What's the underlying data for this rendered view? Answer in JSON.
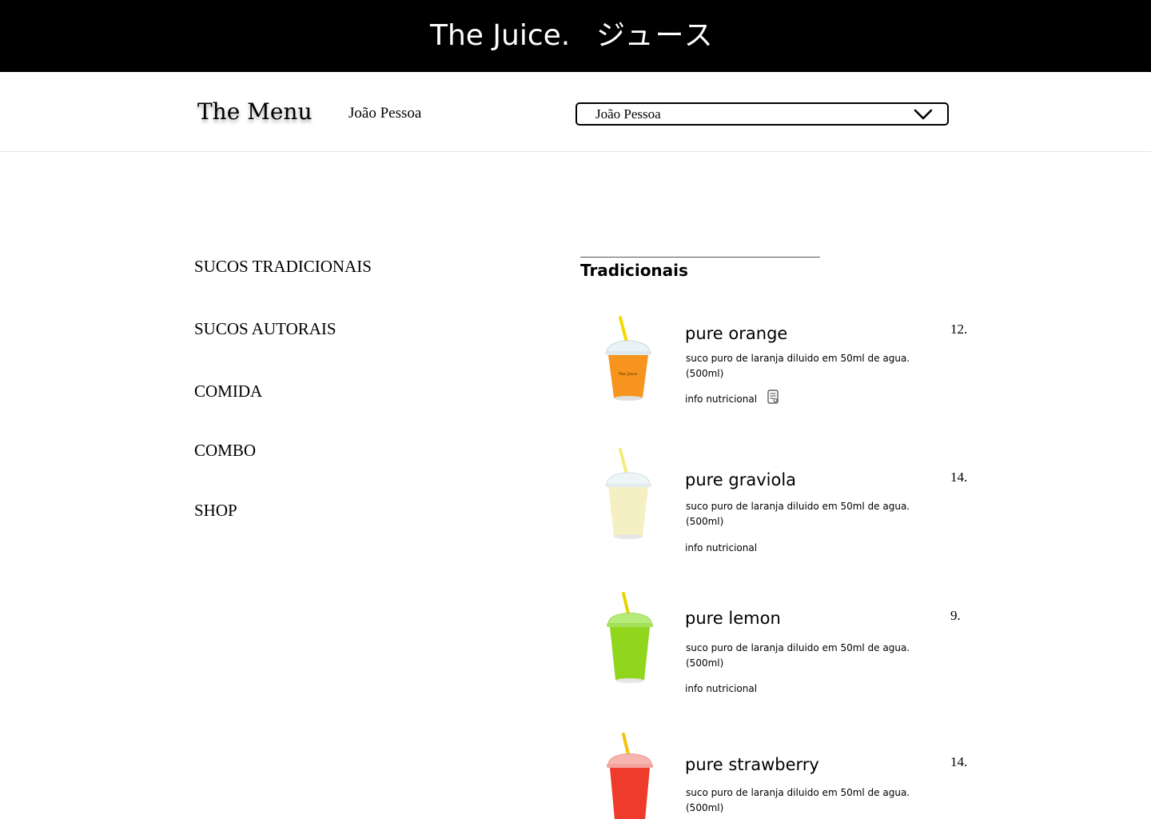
{
  "header": {
    "brand": "The Juice.",
    "brand_japanese": "ジュース",
    "background_color": "#000000",
    "text_color": "#ffffff"
  },
  "subheader": {
    "title": "The Menu",
    "city_label": "João Pessoa",
    "city_select": {
      "value": "João Pessoa",
      "icon": "chevron-down-icon"
    }
  },
  "categories": [
    "SUCOS TRADICIONAIS",
    "SUCOS AUTORAIS",
    "COMIDA",
    "COMBO",
    "SHOP"
  ],
  "section": {
    "title": "Tradicionais"
  },
  "products": [
    {
      "name": "pure orange",
      "price": "12.",
      "description": "suco puro de laranja diluido em 50ml de agua. (500ml)",
      "info_label": "info nutricional",
      "juice_color": "#f7941d",
      "straw_color": "#f5d800",
      "cup_label": "The Juice.",
      "info_icon": "nutrition-document-icon"
    },
    {
      "name": "pure graviola",
      "price": "14.",
      "description": "suco puro de laranja diluido em 50ml de agua. (500ml)",
      "info_label": "info nutricional",
      "juice_color": "#f5f0c4",
      "straw_color": "#f4ec7a"
    },
    {
      "name": "pure lemon",
      "price": "9.",
      "description": "suco puro de laranja diluido em 50ml de agua. (500ml)",
      "info_label": "info nutricional",
      "juice_color": "#8fd61c",
      "straw_color": "#e7d400"
    },
    {
      "name": "pure strawberry",
      "price": "14.",
      "description": "suco puro de laranja diluido em 50ml de agua. (500ml)",
      "info_label": "",
      "juice_color": "#ee3b2c",
      "straw_color": "#f4c20d"
    }
  ]
}
